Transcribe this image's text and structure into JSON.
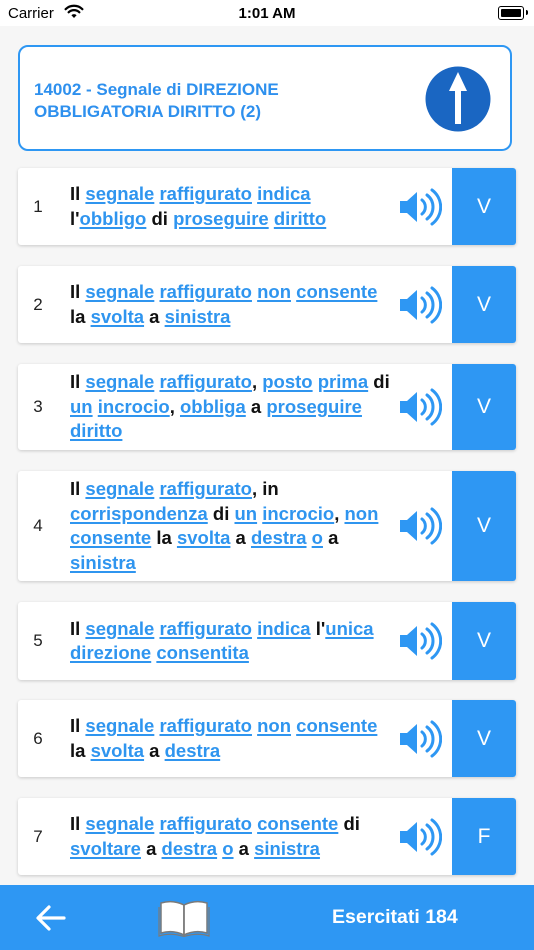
{
  "status_bar": {
    "carrier": "Carrier",
    "time": "1:01 AM"
  },
  "header": {
    "title": "14002 - Segnale di DIREZIONE OBBLIGATORIA DIRITTO (2)",
    "sign_icon": "arrow-up-mandatory-sign",
    "sign_color": "#1a66c2"
  },
  "questions": [
    {
      "num": "1",
      "answer": "V",
      "tokens": [
        [
          "Il",
          0
        ],
        [
          " ",
          0
        ],
        [
          "segnale",
          1
        ],
        [
          " ",
          0
        ],
        [
          "raffigurato",
          1
        ],
        [
          " ",
          0
        ],
        [
          "indica",
          1
        ],
        [
          " ",
          0
        ],
        [
          "l'",
          0
        ],
        [
          "obbligo",
          1
        ],
        [
          " di ",
          0
        ],
        [
          "proseguire",
          1
        ],
        [
          " ",
          0
        ],
        [
          "diritto",
          1
        ]
      ]
    },
    {
      "num": "2",
      "answer": "V",
      "tokens": [
        [
          "Il",
          0
        ],
        [
          " ",
          0
        ],
        [
          "segnale",
          1
        ],
        [
          " ",
          0
        ],
        [
          "raffigurato",
          1
        ],
        [
          " ",
          0
        ],
        [
          "non",
          1
        ],
        [
          " ",
          0
        ],
        [
          "consente",
          1
        ],
        [
          " la ",
          0
        ],
        [
          "svolta",
          1
        ],
        [
          " a ",
          0
        ],
        [
          "sinistra",
          1
        ]
      ]
    },
    {
      "num": "3",
      "answer": "V",
      "tokens": [
        [
          "Il",
          0
        ],
        [
          " ",
          0
        ],
        [
          "segnale",
          1
        ],
        [
          " ",
          0
        ],
        [
          "raffigurato",
          1
        ],
        [
          ", ",
          0
        ],
        [
          "posto",
          1
        ],
        [
          " ",
          0
        ],
        [
          "prima",
          1
        ],
        [
          " di ",
          0
        ],
        [
          "un",
          1
        ],
        [
          " ",
          0
        ],
        [
          "incrocio",
          1
        ],
        [
          ", ",
          0
        ],
        [
          "obbliga",
          1
        ],
        [
          " a ",
          0
        ],
        [
          "proseguire",
          1
        ],
        [
          " ",
          0
        ],
        [
          "diritto",
          1
        ]
      ]
    },
    {
      "num": "4",
      "answer": "V",
      "tokens": [
        [
          "Il",
          0
        ],
        [
          " ",
          0
        ],
        [
          "segnale",
          1
        ],
        [
          " ",
          0
        ],
        [
          "raffigurato",
          1
        ],
        [
          ", in ",
          0
        ],
        [
          "corrispondenza",
          1
        ],
        [
          " di ",
          0
        ],
        [
          "un",
          1
        ],
        [
          " ",
          0
        ],
        [
          "incrocio",
          1
        ],
        [
          ", ",
          0
        ],
        [
          "non",
          1
        ],
        [
          " ",
          0
        ],
        [
          "consente",
          1
        ],
        [
          " la ",
          0
        ],
        [
          "svolta",
          1
        ],
        [
          " a ",
          0
        ],
        [
          "destra",
          1
        ],
        [
          " ",
          0
        ],
        [
          "o",
          1
        ],
        [
          " a ",
          0
        ],
        [
          "sinistra",
          1
        ]
      ]
    },
    {
      "num": "5",
      "answer": "V",
      "tokens": [
        [
          "Il",
          0
        ],
        [
          " ",
          0
        ],
        [
          "segnale",
          1
        ],
        [
          " ",
          0
        ],
        [
          "raffigurato",
          1
        ],
        [
          " ",
          0
        ],
        [
          "indica",
          1
        ],
        [
          " ",
          0
        ],
        [
          "l'",
          0
        ],
        [
          "unica",
          1
        ],
        [
          " ",
          0
        ],
        [
          "direzione",
          1
        ],
        [
          " ",
          0
        ],
        [
          "consentita",
          1
        ]
      ]
    },
    {
      "num": "6",
      "answer": "V",
      "tokens": [
        [
          "Il",
          0
        ],
        [
          " ",
          0
        ],
        [
          "segnale",
          1
        ],
        [
          " ",
          0
        ],
        [
          "raffigurato",
          1
        ],
        [
          " ",
          0
        ],
        [
          "non",
          1
        ],
        [
          " ",
          0
        ],
        [
          "consente",
          1
        ],
        [
          " la ",
          0
        ],
        [
          "svolta",
          1
        ],
        [
          " a ",
          0
        ],
        [
          "destra",
          1
        ]
      ]
    },
    {
      "num": "7",
      "answer": "F",
      "tokens": [
        [
          "Il",
          0
        ],
        [
          " ",
          0
        ],
        [
          "segnale",
          1
        ],
        [
          " ",
          0
        ],
        [
          "raffigurato",
          1
        ],
        [
          " ",
          0
        ],
        [
          "consente",
          1
        ],
        [
          " ",
          0
        ],
        [
          "di",
          0
        ],
        [
          " ",
          0
        ],
        [
          "svoltare",
          1
        ],
        [
          " a ",
          0
        ],
        [
          "destra",
          1
        ],
        [
          " ",
          0
        ],
        [
          "o",
          1
        ],
        [
          " a ",
          0
        ],
        [
          "sinistra",
          1
        ]
      ]
    }
  ],
  "bottom_bar": {
    "back_icon": "arrow-left-icon",
    "book_icon": "open-book-icon",
    "practiced_label": "Esercitati 184"
  },
  "colors": {
    "accent": "#2e97f3",
    "link": "#2f95ef"
  }
}
